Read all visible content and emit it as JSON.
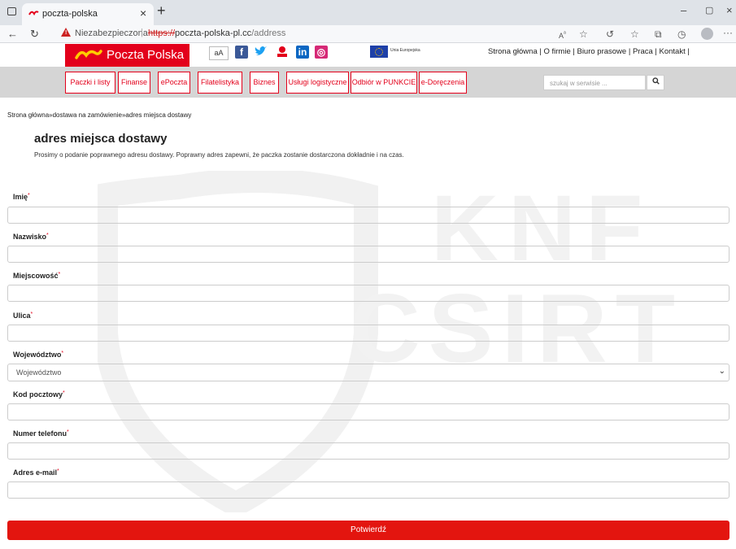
{
  "browser": {
    "tab_title": "poczta-polska",
    "url_warning": "Niezabezpieczona",
    "url_scheme": "https://",
    "url_host": "poczta-polska-pl.cc",
    "url_path": "/address"
  },
  "header": {
    "logo_text": "Poczta Polska",
    "font_size_toggle": "aA",
    "eu_label": "Unia Europejska",
    "top_links": "Strona główna | O firmie | Biuro prasowe | Praca | Kontakt |"
  },
  "nav": {
    "items": [
      "Paczki i listy",
      "Finanse",
      "ePoczta",
      "Filatelistyka",
      "Biznes",
      "Usługi logistyczne",
      "Odbiór w PUNKCIE",
      "e-Doręczenia"
    ],
    "search_placeholder": "szukaj w serwisie ..."
  },
  "page": {
    "breadcrumb": "Strona główna»dostawa na zamówienie»adres miejsca dostawy",
    "title": "adres miejsca dostawy",
    "subtitle": "Prosimy o podanie poprawnego adresu dostawy. Poprawny adres zapewni, że paczka zostanie dostarczona dokładnie i na czas.",
    "watermark": [
      "KNF",
      "CSIRT"
    ]
  },
  "form": {
    "required_marker": "*",
    "fields": [
      {
        "label": "Imię",
        "value": ""
      },
      {
        "label": "Nazwisko",
        "value": ""
      },
      {
        "label": "Miejscowość",
        "value": ""
      },
      {
        "label": "Ulica",
        "value": ""
      },
      {
        "label": "Województwo",
        "value": "Województwo"
      },
      {
        "label": "Kod pocztowy",
        "value": ""
      },
      {
        "label": "Numer telefonu",
        "value": ""
      },
      {
        "label": "Adres e-mail",
        "value": ""
      }
    ],
    "submit_label": "Potwierdź"
  },
  "colors": {
    "brand_red": "#e3001b",
    "brand_yellow": "#ffcc00",
    "nav_bg": "#d5d5d5"
  }
}
